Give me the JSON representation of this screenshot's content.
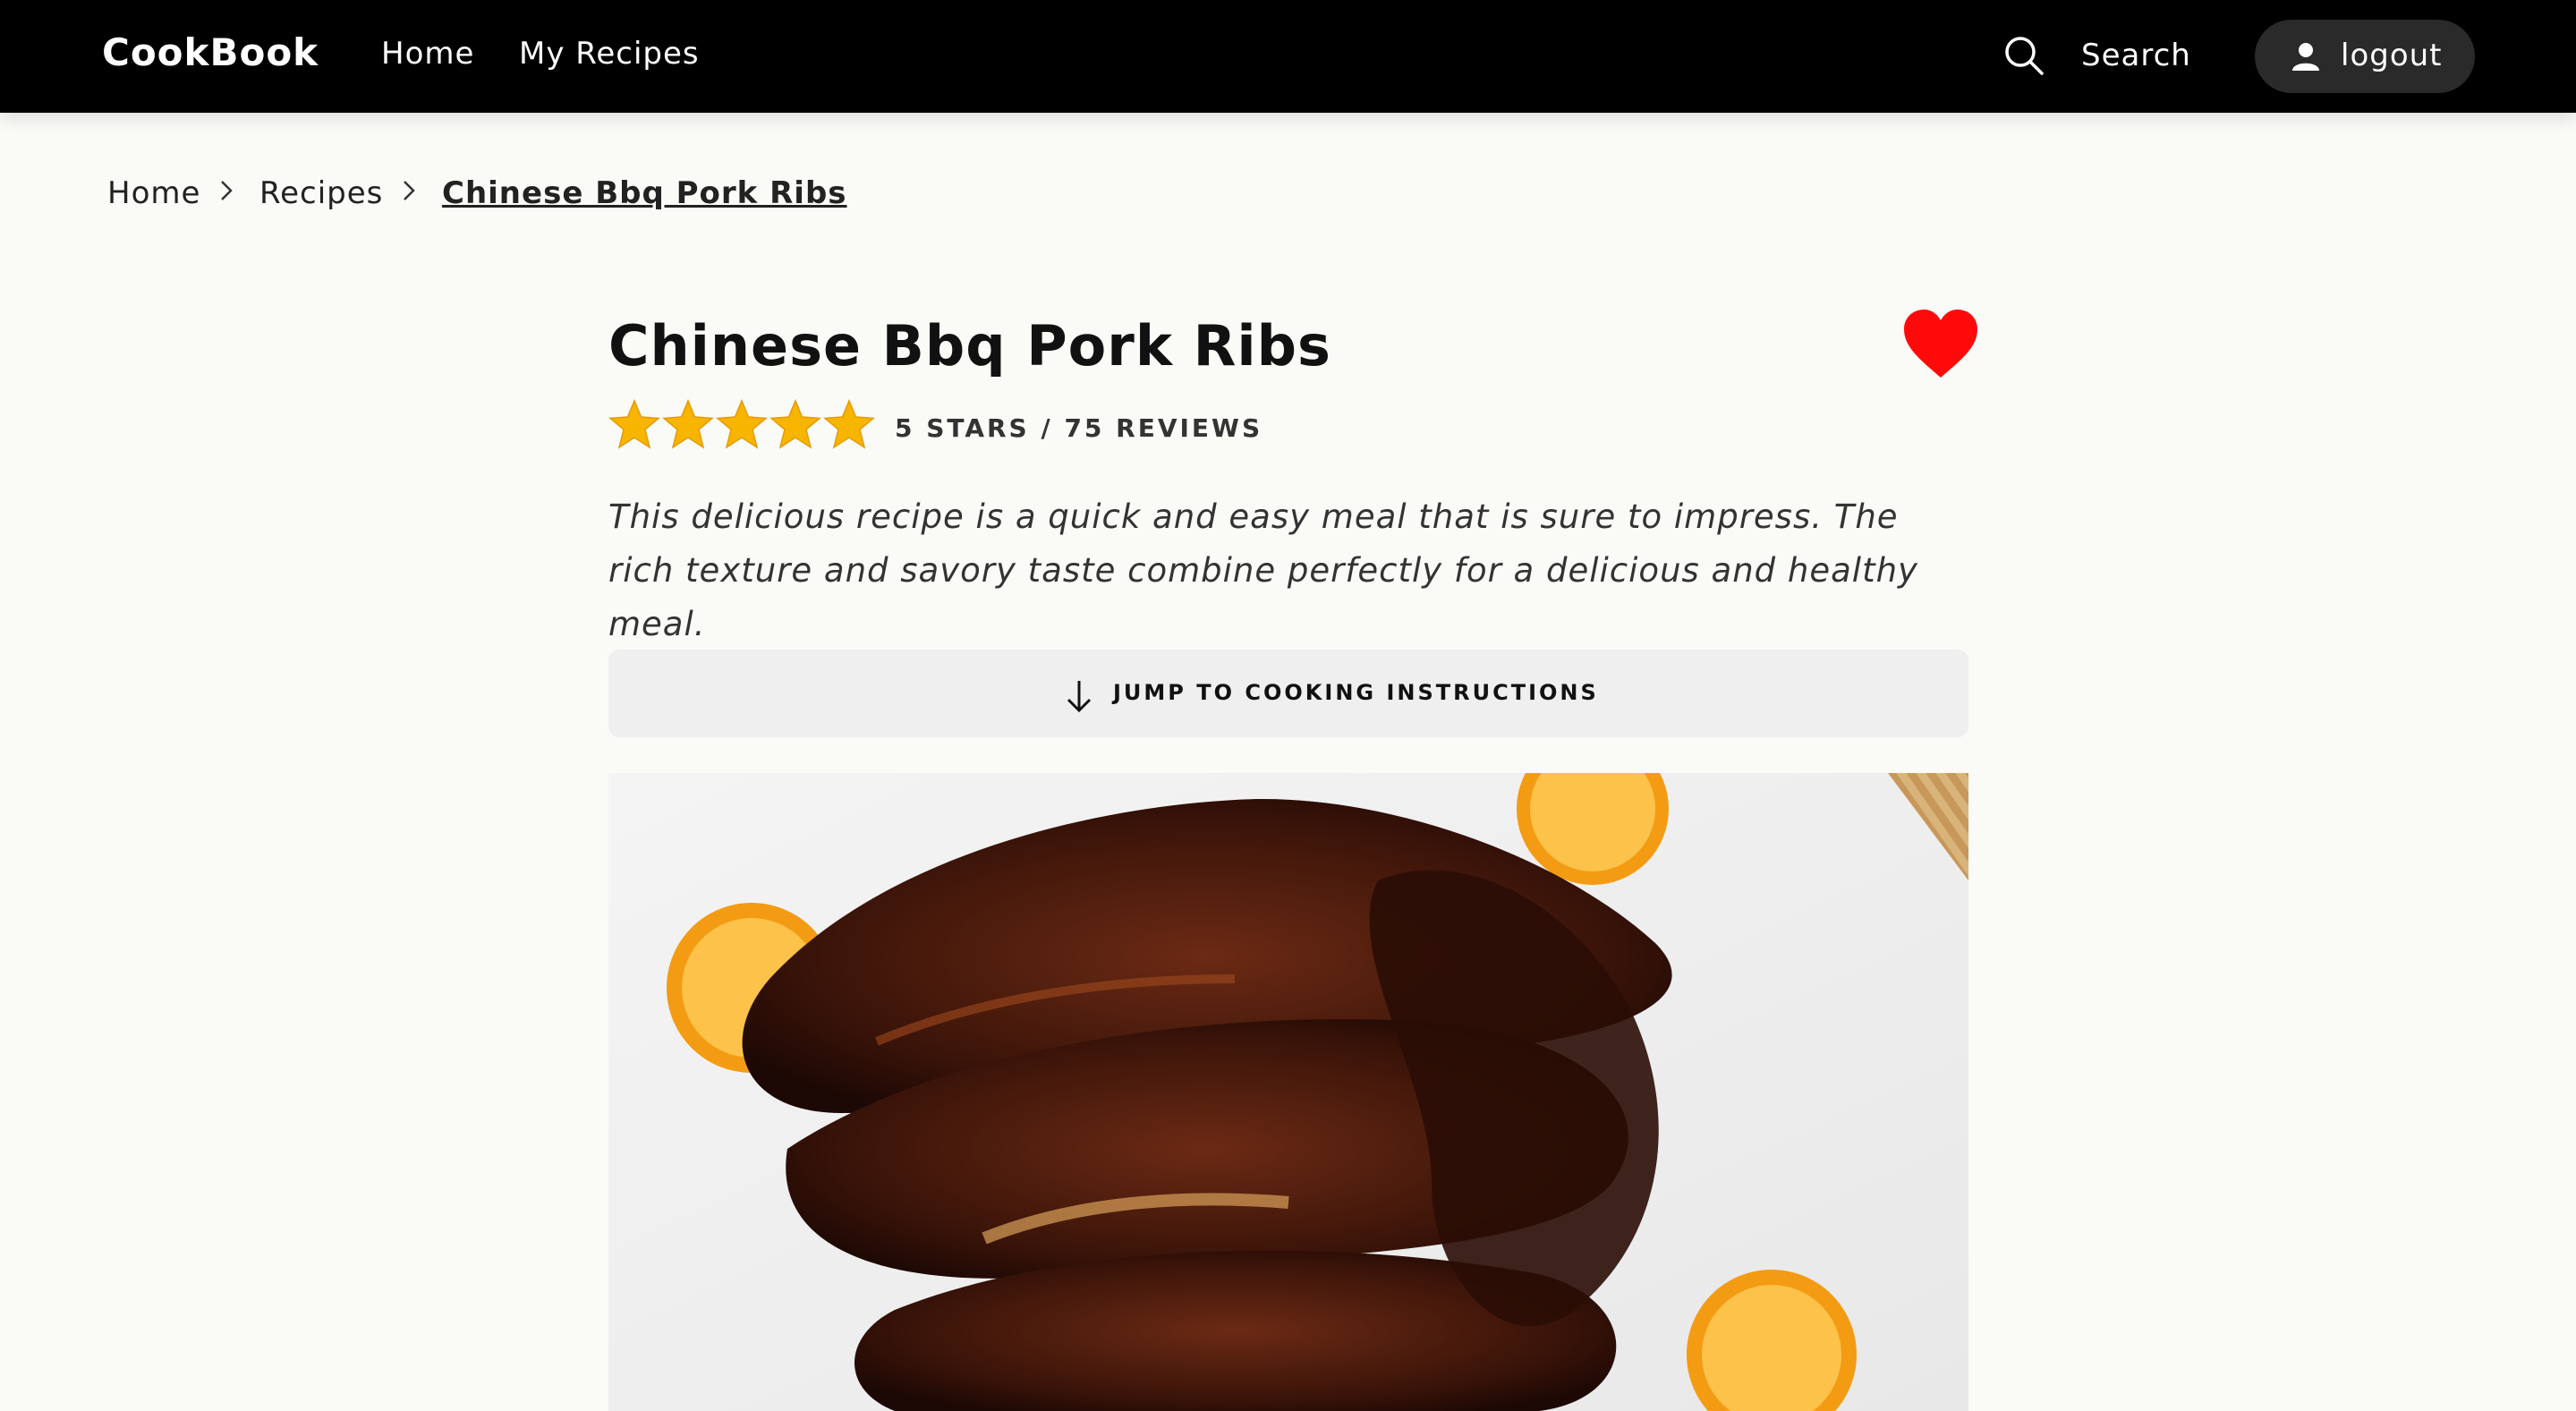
{
  "nav": {
    "brand": "CookBook",
    "links": [
      "Home",
      "My Recipes"
    ],
    "search_label": "Search",
    "logout_label": "logout"
  },
  "breadcrumb": {
    "items": [
      "Home",
      "Recipes",
      "Chinese Bbq Pork Ribs"
    ]
  },
  "recipe": {
    "title": "Chinese Bbq Pork Ribs",
    "favorited": true,
    "rating_stars": 5,
    "rating_text": "5 STARS / 75 REVIEWS",
    "description": "This delicious recipe is a quick and easy meal that is sure to impress. The rich texture and savory taste combine perfectly for a delicious and healthy meal.",
    "jump_label": "JUMP TO COOKING INSTRUCTIONS",
    "image_subject": "bbq-pork-ribs-photo"
  },
  "colors": {
    "navbar_bg": "#000000",
    "page_bg": "#fafaf7",
    "star": "#f7b500",
    "heart": "#ff0a0a",
    "logout_bg": "#2a2a2a",
    "jump_bg": "#efefef"
  }
}
